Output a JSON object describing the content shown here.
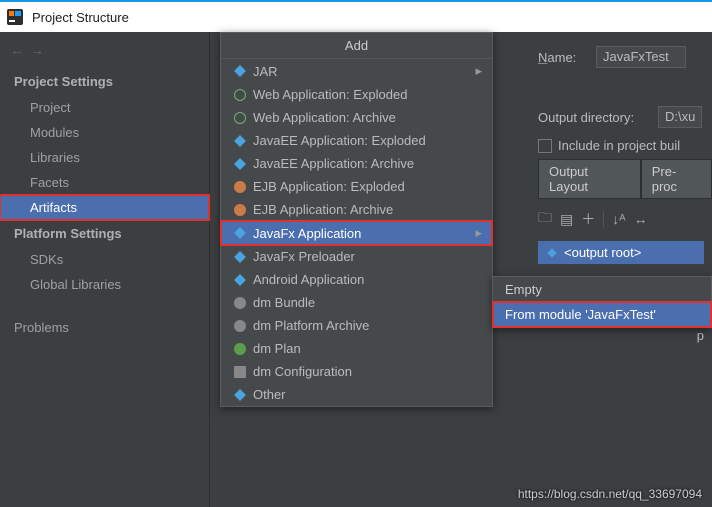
{
  "window": {
    "title": "Project Structure"
  },
  "sidebar": {
    "heads": {
      "project": "Project Settings",
      "platform": "Platform Settings"
    },
    "project_items": [
      "Project",
      "Modules",
      "Libraries",
      "Facets",
      "Artifacts"
    ],
    "platform_items": [
      "SDKs",
      "Global Libraries"
    ],
    "problems": "Problems"
  },
  "addmenu": {
    "title": "Add",
    "items": [
      {
        "label": "JAR",
        "arrow": true
      },
      {
        "label": "Web Application: Exploded"
      },
      {
        "label": "Web Application: Archive"
      },
      {
        "label": "JavaEE Application: Exploded"
      },
      {
        "label": "JavaEE Application: Archive"
      },
      {
        "label": "EJB Application: Exploded"
      },
      {
        "label": "EJB Application: Archive"
      },
      {
        "label": "JavaFx Application",
        "arrow": true,
        "selected": true
      },
      {
        "label": "JavaFx Preloader"
      },
      {
        "label": "Android Application"
      },
      {
        "label": "dm Bundle"
      },
      {
        "label": "dm Platform Archive"
      },
      {
        "label": "dm Plan"
      },
      {
        "label": "dm Configuration"
      },
      {
        "label": "Other"
      }
    ]
  },
  "submenu": {
    "items": [
      "Empty",
      "From module 'JavaFxTest'"
    ]
  },
  "form": {
    "name_label": "Name:",
    "name_value": "JavaFxTest",
    "outdir_label": "Output directory:",
    "outdir_value": "D:\\xu",
    "include_label": "Include in project buil",
    "tabs": [
      "Output Layout",
      "Pre-proc"
    ],
    "output_root": "<output root>",
    "truncated_p": "p"
  },
  "watermark": "https://blog.csdn.net/qq_33697094"
}
